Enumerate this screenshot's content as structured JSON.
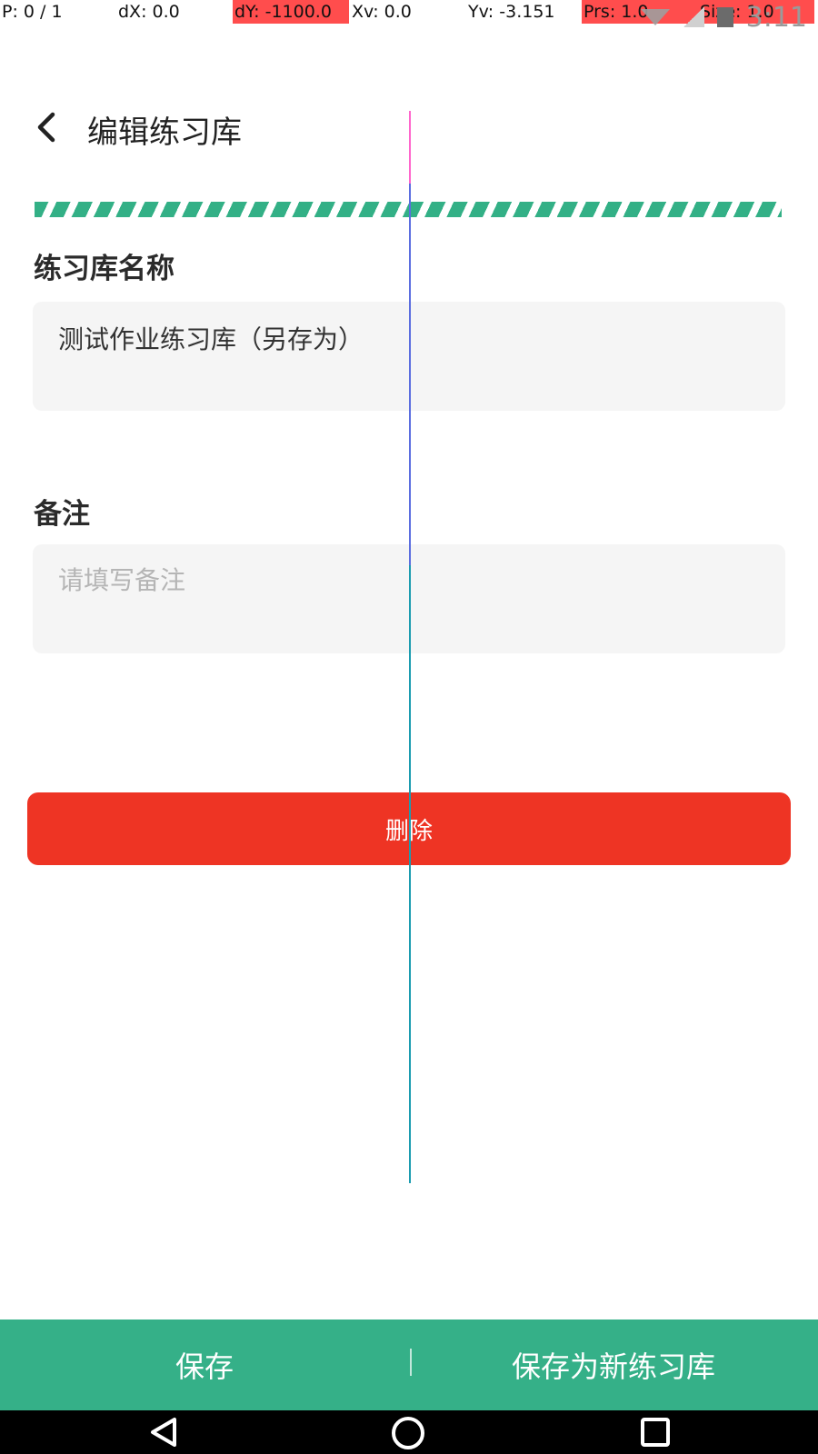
{
  "debug": {
    "pointer": "P: 0 / 1",
    "dx": "dX: 0.0",
    "dy": "dY: -1100.0",
    "xv": "Xv: 0.0",
    "yv": "Yv: -3.151",
    "prs": "Prs: 1.0",
    "size": "Size: 1.0"
  },
  "status_bar": {
    "time": "3:11",
    "icons": [
      "wifi-icon",
      "no-signal-icon",
      "battery-icon"
    ]
  },
  "header": {
    "title": "编辑练习库",
    "back_icon": "chevron-left-icon"
  },
  "form": {
    "name_label": "练习库名称",
    "name_value": "测试作业练习库（另存为）",
    "remark_label": "备注",
    "remark_placeholder": "请填写备注"
  },
  "delete_label": "删除",
  "bottom_bar": {
    "save_label": "保存",
    "save_new_label": "保存为新练习库"
  },
  "colors": {
    "accent": "#35b088",
    "danger": "#ee3424"
  },
  "nav": {
    "icons": [
      "back-triangle-icon",
      "home-circle-icon",
      "recents-square-icon"
    ]
  }
}
